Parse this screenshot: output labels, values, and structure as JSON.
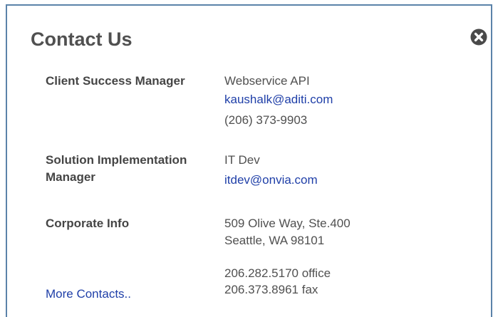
{
  "dialog": {
    "title": "Contact Us",
    "close_icon": "close-circle-icon"
  },
  "contacts": [
    {
      "label": "Client Success Manager",
      "name": "Webservice API",
      "email": "kaushalk@aditi.com",
      "phone": "(206) 373-9903"
    },
    {
      "label": "Solution Implementation Manager",
      "name": "IT Dev",
      "email": "itdev@onvia.com"
    },
    {
      "label": "Corporate Info",
      "address_line1": "509 Olive Way, Ste.400",
      "address_line2": "Seattle, WA 98101",
      "office_phone": "206.282.5170 office",
      "fax": "206.373.8961 fax"
    }
  ],
  "footer": {
    "more_contacts": "More Contacts.."
  },
  "colors": {
    "border": "#5b83a9",
    "link": "#1f3fa8",
    "title_text": "#505050",
    "close_icon": "#4a4a4a"
  }
}
